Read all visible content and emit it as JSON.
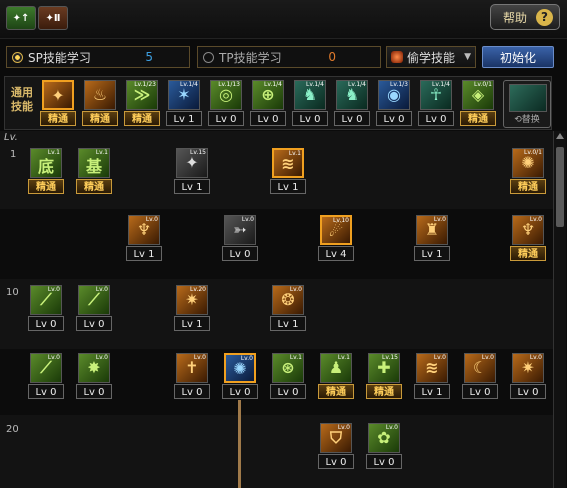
{
  "header": {
    "tab1_label": "✦↑",
    "tab2_label": "✦Ⅱ",
    "help_label": "帮助",
    "help_icon": "?"
  },
  "points": {
    "sp_label": "SP技能学习",
    "sp_value": "5",
    "tp_label": "TP技能学习",
    "tp_value": "0"
  },
  "job_select": {
    "value": "偷学技能",
    "arrow": "▼"
  },
  "init_button": "初始化",
  "general": {
    "label": "通用技能",
    "skills": [
      {
        "label": "精通",
        "gold": true,
        "color": "orange",
        "glyph": "✦",
        "badge": "",
        "sel": true
      },
      {
        "label": "精通",
        "gold": true,
        "color": "orange",
        "glyph": "♨",
        "badge": ""
      },
      {
        "label": "精通",
        "gold": true,
        "color": "green",
        "glyph": "≫",
        "badge": "Lv.1/23"
      },
      {
        "label": "Lv 1",
        "gold": false,
        "color": "blue",
        "glyph": "✶",
        "badge": "Lv.1/4"
      },
      {
        "label": "Lv 0",
        "gold": false,
        "color": "green",
        "glyph": "◎",
        "badge": "Lv.1/13"
      },
      {
        "label": "Lv 0",
        "gold": false,
        "color": "green",
        "glyph": "⊕",
        "badge": "Lv.1/4"
      },
      {
        "label": "Lv 0",
        "gold": false,
        "color": "teal",
        "glyph": "♞",
        "badge": "Lv.1/4"
      },
      {
        "label": "Lv 0",
        "gold": false,
        "color": "teal",
        "glyph": "♞",
        "badge": "Lv.1/4"
      },
      {
        "label": "Lv 0",
        "gold": false,
        "color": "blue",
        "glyph": "◉",
        "badge": "Lv.1/3"
      },
      {
        "label": "Lv 0",
        "gold": false,
        "color": "teal",
        "glyph": "☥",
        "badge": "Lv.1/4"
      },
      {
        "label": "精通",
        "gold": true,
        "color": "green",
        "glyph": "◈",
        "badge": "Lv.0/1"
      }
    ],
    "swap_label": "⟲替换"
  },
  "tree": {
    "lv_header": "Lv.",
    "level_labels": [
      "1",
      "10",
      "20"
    ],
    "skills": [
      {
        "label": "精通",
        "gold": true,
        "color": "green",
        "glyph": "底",
        "badge": "Lv.1"
      },
      {
        "label": "精通",
        "gold": true,
        "color": "green",
        "glyph": "基",
        "badge": "Lv.1"
      },
      {
        "label": "Lv 1",
        "gold": false,
        "color": "gray",
        "glyph": "✦",
        "badge": "Lv.15"
      },
      {
        "label": "Lv 1",
        "gold": false,
        "color": "orange",
        "glyph": "≋",
        "badge": "Lv.1",
        "sel": true
      },
      {
        "label": "精通",
        "gold": true,
        "color": "orange",
        "glyph": "✺",
        "badge": "Lv.0/1"
      },
      {
        "label": "Lv 1",
        "gold": false,
        "color": "orange",
        "glyph": "♆",
        "badge": "Lv.0"
      },
      {
        "label": "Lv 0",
        "gold": false,
        "color": "gray",
        "glyph": "➳",
        "badge": "Lv.0"
      },
      {
        "label": "Lv 4",
        "gold": false,
        "color": "orange",
        "glyph": "☄",
        "badge": "Lv.10",
        "sel": true
      },
      {
        "label": "Lv 1",
        "gold": false,
        "color": "orange",
        "glyph": "♜",
        "badge": "Lv.0"
      },
      {
        "label": "精通",
        "gold": true,
        "color": "orange",
        "glyph": "♆",
        "badge": "Lv.0"
      },
      {
        "label": "Lv 0",
        "gold": false,
        "color": "green",
        "glyph": "⟋",
        "badge": "Lv.0"
      },
      {
        "label": "Lv 0",
        "gold": false,
        "color": "green",
        "glyph": "⟋",
        "badge": "Lv.0"
      },
      {
        "label": "Lv 1",
        "gold": false,
        "color": "orange",
        "glyph": "✷",
        "badge": "Lv.20"
      },
      {
        "label": "Lv 1",
        "gold": false,
        "color": "orange",
        "glyph": "❂",
        "badge": "Lv.0"
      },
      {
        "label": "Lv 0",
        "gold": false,
        "color": "green",
        "glyph": "⟋",
        "badge": "Lv.0"
      },
      {
        "label": "Lv 0",
        "gold": false,
        "color": "green",
        "glyph": "✸",
        "badge": "Lv.0"
      },
      {
        "label": "Lv 0",
        "gold": false,
        "color": "orange",
        "glyph": "✝",
        "badge": "Lv.0"
      },
      {
        "label": "Lv 0",
        "gold": false,
        "color": "blue",
        "glyph": "✺",
        "badge": "Lv.0",
        "sel": true
      },
      {
        "label": "Lv 0",
        "gold": false,
        "color": "green",
        "glyph": "⊛",
        "badge": "Lv.1"
      },
      {
        "label": "精通",
        "gold": true,
        "color": "green",
        "glyph": "♟",
        "badge": "Lv.1"
      },
      {
        "label": "精通",
        "gold": true,
        "color": "green",
        "glyph": "✚",
        "badge": "Lv.15"
      },
      {
        "label": "Lv 1",
        "gold": false,
        "color": "orange",
        "glyph": "≋",
        "badge": "Lv.0"
      },
      {
        "label": "Lv 0",
        "gold": false,
        "color": "orange",
        "glyph": "☾",
        "badge": "Lv.0"
      },
      {
        "label": "Lv 0",
        "gold": false,
        "color": "orange",
        "glyph": "✷",
        "badge": "Lv.0"
      },
      {
        "label": "Lv 0",
        "gold": false,
        "color": "orange",
        "glyph": "⛉",
        "badge": "Lv.0"
      },
      {
        "label": "Lv 0",
        "gold": false,
        "color": "green",
        "glyph": "✿",
        "badge": "Lv.0"
      }
    ]
  },
  "colors": {
    "gold": "#ffce5a",
    "sp": "#3d9fe0",
    "tp": "#e07a2c",
    "init": "#3a62a8"
  }
}
